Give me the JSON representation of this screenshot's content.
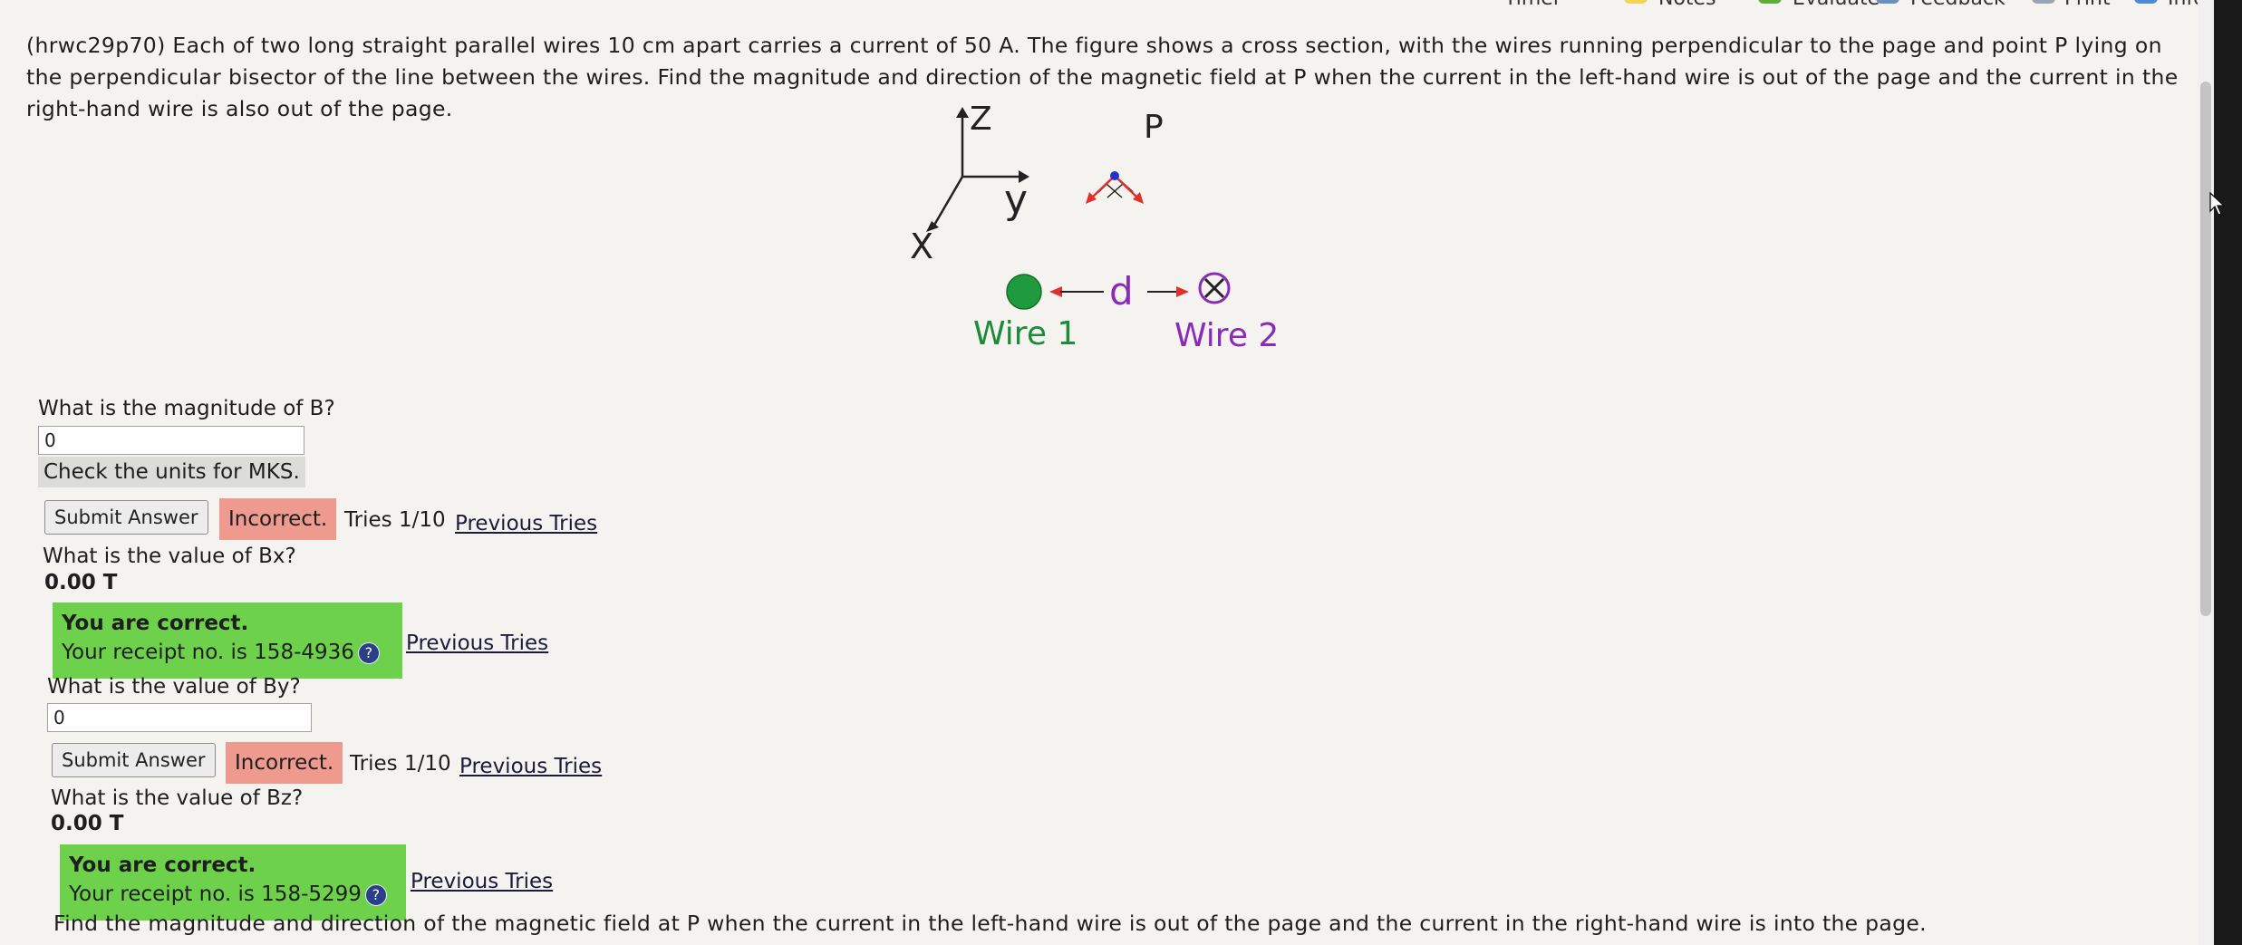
{
  "toolbar": {
    "items": [
      "Timer",
      "Notes",
      "Evaluate",
      "Feedback",
      "Print",
      "Info"
    ]
  },
  "question": {
    "text": "(hrwc29p70) Each of two long straight parallel wires 10 cm apart carries a current of 50 A. The figure shows a cross section, with the wires running perpendicular to the page and point P lying on the perpendicular bisector of the line between the wires. Find the magnitude and direction of the magnetic field at P when the current in the left-hand wire is out of the page and the current in the right-hand wire is also out of the page."
  },
  "figure": {
    "axis_z": "Z",
    "axis_y": "y",
    "axis_x": "X",
    "point_p": "P",
    "distance": "d",
    "wire1": "Wire 1",
    "wire2": "Wire 2",
    "colors": {
      "wire1": "#1f9a3c",
      "wire2": "#8a2bb8",
      "arrows": "#e0312a",
      "point": "#2233cc"
    }
  },
  "parts": {
    "b_mag": {
      "question": "What is the magnitude of B?",
      "value": "0",
      "hint": "Check the units for MKS.",
      "submit": "Submit Answer",
      "status": "Incorrect.",
      "tries": "Tries 1/10",
      "prev": "Previous Tries"
    },
    "bx": {
      "question": "What is the value of Bx?",
      "answer": "0.00 T",
      "correct": "You are correct.",
      "receipt": "Your receipt no. is 158-4936",
      "prev": "Previous Tries"
    },
    "by": {
      "question": "What is the value of By?",
      "value": "0",
      "submit": "Submit Answer",
      "status": "Incorrect.",
      "tries": "Tries 1/10",
      "prev": "Previous Tries"
    },
    "bz": {
      "question": "What is the value of Bz?",
      "answer": "0.00 T",
      "correct": "You are correct.",
      "receipt": "Your receipt no. is 158-5299",
      "prev": "Previous Tries"
    }
  },
  "next_question": "Find the magnitude and direction of the magnetic field at P when the current in the left-hand wire is out of the page and the current in the right-hand wire is into the page."
}
